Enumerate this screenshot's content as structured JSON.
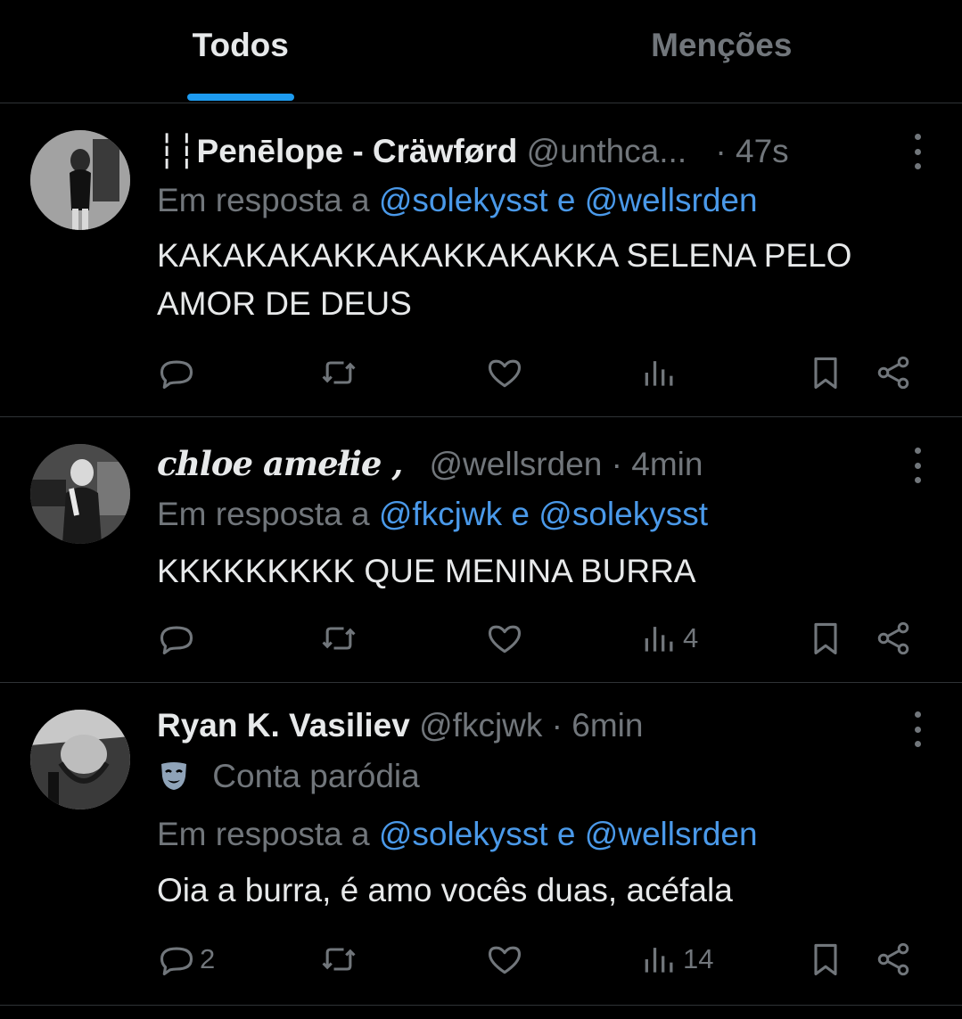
{
  "tabs": [
    {
      "label": "Todos",
      "active": true
    },
    {
      "label": "Menções",
      "active": false
    }
  ],
  "tweets": [
    {
      "name": "┆┆Penēlope - Cräwførd",
      "handle": "@unthca...",
      "time": "· 47s",
      "reply_prefix": "Em resposta a",
      "reply_mentions": [
        "@solekysst",
        "@wellsrden"
      ],
      "reply_joiner": "e",
      "text": "KAKAKAKAKKAKAKKAKAKKA SELENA PELO AMOR DE DEUS",
      "replies": "",
      "views": ""
    },
    {
      "name": "cհloe amełie ,",
      "handle": "@wellsrden",
      "time": "· 4min",
      "reply_prefix": "Em resposta a",
      "reply_mentions": [
        "@fkcjwk",
        "@solekysst"
      ],
      "reply_joiner": "e",
      "text": "KKKKKKKKK QUE MENINA BURRA",
      "replies": "",
      "views": "4"
    },
    {
      "name": "Ryan K. Vasiliev",
      "handle": "@fkcjwk",
      "time": "· 6min",
      "parody_label": "Conta paródia",
      "reply_prefix": "Em resposta a",
      "reply_mentions": [
        "@solekysst",
        "@wellsrden"
      ],
      "reply_joiner": "e",
      "text": "Oia a burra, é amo vocês duas, acéfala",
      "replies": "2",
      "views": "14"
    }
  ],
  "icons": {
    "reply": "reply-icon",
    "retweet": "retweet-icon",
    "like": "like-icon",
    "views": "views-icon",
    "bookmark": "bookmark-icon",
    "share": "share-icon",
    "more": "more-icon",
    "parody": "parody-mask-icon"
  },
  "colors": {
    "background": "#000000",
    "text": "#e7e9ea",
    "muted": "#71767b",
    "mention": "#4a99e9",
    "accent": "#1d9bf0",
    "divider": "#2f3336"
  }
}
